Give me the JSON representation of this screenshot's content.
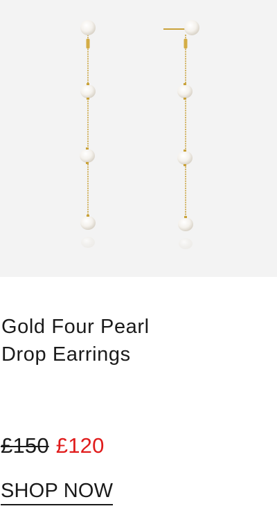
{
  "product": {
    "image_alt": "Gold Four Pearl Drop Earrings",
    "title": "Gold Four Pearl\nDrop Earrings",
    "price_original": "£150",
    "price_sale": "£120",
    "cta_label": "SHOP NOW"
  },
  "colors": {
    "image_background": "#f3f3f3",
    "text": "#1a1a1a",
    "sale_price": "#e01b1b",
    "gold_chain": "#c9a23a"
  }
}
